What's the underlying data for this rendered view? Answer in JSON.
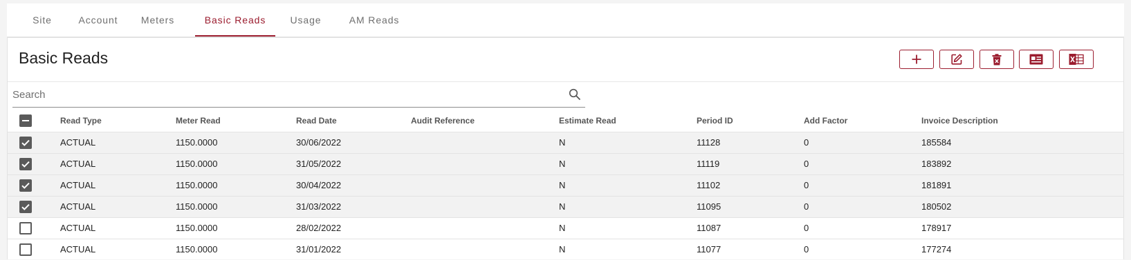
{
  "tabs": [
    {
      "label": "Site"
    },
    {
      "label": "Account"
    },
    {
      "label": "Meters"
    },
    {
      "label": "Basic Reads"
    },
    {
      "label": "Usage"
    },
    {
      "label": "AM Reads"
    }
  ],
  "active_tab": "Basic Reads",
  "panel": {
    "title": "Basic Reads"
  },
  "toolbar": {
    "buttons": [
      {
        "name": "add-button",
        "icon": "plus-icon"
      },
      {
        "name": "edit-button",
        "icon": "edit-icon"
      },
      {
        "name": "delete-button",
        "icon": "trash-icon"
      },
      {
        "name": "details-button",
        "icon": "id-card-icon"
      },
      {
        "name": "export-excel-button",
        "icon": "excel-icon"
      }
    ],
    "accent_color": "#9b1c2e"
  },
  "search": {
    "placeholder": "Search",
    "value": ""
  },
  "table": {
    "columns": [
      "Read Type",
      "Meter Read",
      "Read Date",
      "Audit Reference",
      "Estimate Read",
      "Period ID",
      "Add Factor",
      "Invoice Description"
    ],
    "header_checkbox": "indeterminate",
    "rows": [
      {
        "checked": true,
        "cells": [
          "ACTUAL",
          "1150.0000",
          "30/06/2022",
          "",
          "N",
          "11128",
          "0",
          "185584"
        ]
      },
      {
        "checked": true,
        "cells": [
          "ACTUAL",
          "1150.0000",
          "31/05/2022",
          "",
          "N",
          "11119",
          "0",
          "183892"
        ]
      },
      {
        "checked": true,
        "cells": [
          "ACTUAL",
          "1150.0000",
          "30/04/2022",
          "",
          "N",
          "11102",
          "0",
          "181891"
        ]
      },
      {
        "checked": true,
        "cells": [
          "ACTUAL",
          "1150.0000",
          "31/03/2022",
          "",
          "N",
          "11095",
          "0",
          "180502"
        ]
      },
      {
        "checked": false,
        "cells": [
          "ACTUAL",
          "1150.0000",
          "28/02/2022",
          "",
          "N",
          "11087",
          "0",
          "178917"
        ]
      },
      {
        "checked": false,
        "cells": [
          "ACTUAL",
          "1150.0000",
          "31/01/2022",
          "",
          "N",
          "11077",
          "0",
          "177274"
        ]
      }
    ]
  }
}
